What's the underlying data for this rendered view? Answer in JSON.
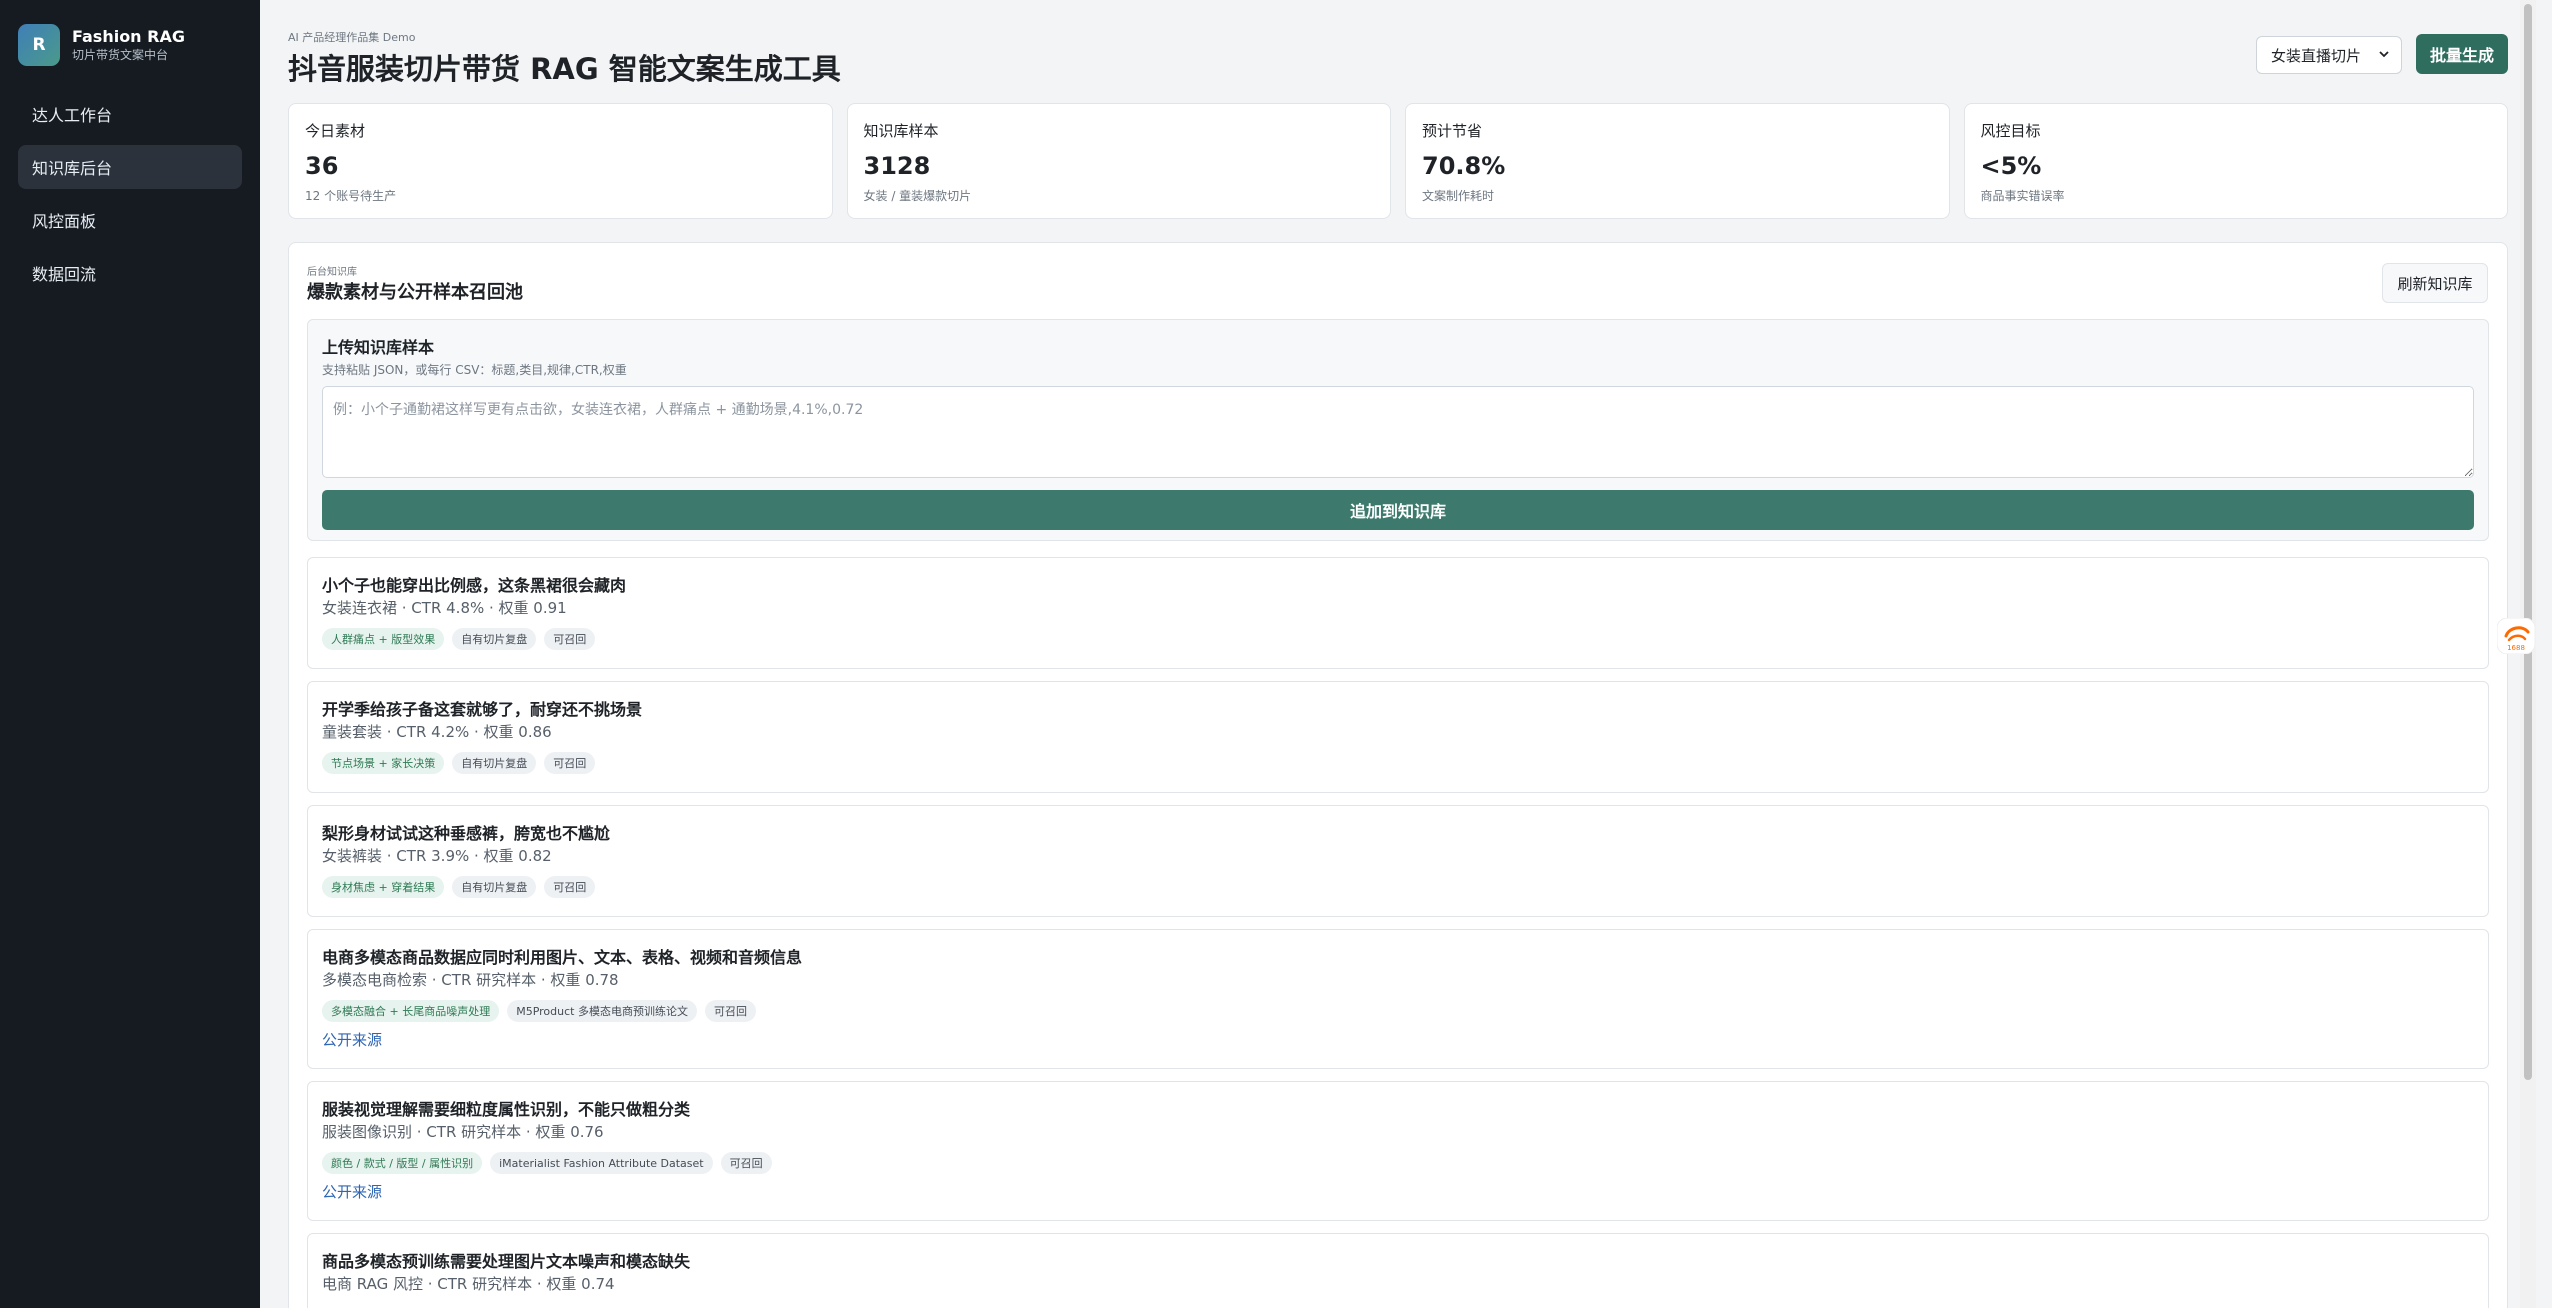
{
  "brand": {
    "logo_letter": "R",
    "name": "Fashion RAG",
    "subtitle": "切片带货文案中台"
  },
  "nav": {
    "items": [
      {
        "label": "达人工作台",
        "active": false
      },
      {
        "label": "知识库后台",
        "active": true
      },
      {
        "label": "风控面板",
        "active": false
      },
      {
        "label": "数据回流",
        "active": false
      }
    ]
  },
  "header": {
    "eyebrow": "AI 产品经理作品集 Demo",
    "title": "抖音服装切片带货 RAG 智能文案生成工具",
    "scene_select": "女装直播切片",
    "batch_button": "批量生成"
  },
  "stats": [
    {
      "label": "今日素材",
      "value": "36",
      "note": "12 个账号待生产"
    },
    {
      "label": "知识库样本",
      "value": "3128",
      "note": "女装 / 童装爆款切片"
    },
    {
      "label": "预计节省",
      "value": "70.8%",
      "note": "文案制作耗时"
    },
    {
      "label": "风控目标",
      "value": "<5%",
      "note": "商品事实错误率"
    }
  ],
  "knowledge": {
    "eyebrow": "后台知识库",
    "title": "爆款素材与公开样本召回池",
    "refresh_button": "刷新知识库",
    "upload": {
      "title": "上传知识库样本",
      "hint": "支持粘贴 JSON，或每行 CSV：标题,类目,规律,CTR,权重",
      "placeholder": "例：小个子通勤裙这样写更有点击欲，女装连衣裙，人群痛点 + 通勤场景,4.1%,0.72",
      "append_button": "追加到知识库"
    },
    "items": [
      {
        "title": "小个子也能穿出比例感，这条黑裙很会藏肉",
        "meta": "女装连衣裙 · CTR 4.8% · 权重 0.91",
        "tags": [
          "人群痛点 + 版型效果",
          "自有切片复盘",
          "可召回"
        ],
        "link": ""
      },
      {
        "title": "开学季给孩子备这套就够了，耐穿还不挑场景",
        "meta": "童装套装 · CTR 4.2% · 权重 0.86",
        "tags": [
          "节点场景 + 家长决策",
          "自有切片复盘",
          "可召回"
        ],
        "link": ""
      },
      {
        "title": "梨形身材试试这种垂感裤，胯宽也不尴尬",
        "meta": "女装裤装 · CTR 3.9% · 权重 0.82",
        "tags": [
          "身材焦虑 + 穿着结果",
          "自有切片复盘",
          "可召回"
        ],
        "link": ""
      },
      {
        "title": "电商多模态商品数据应同时利用图片、文本、表格、视频和音频信息",
        "meta": "多模态电商检索 · CTR 研究样本 · 权重 0.78",
        "tags": [
          "多模态融合 + 长尾商品噪声处理",
          "M5Product 多模态电商预训练论文",
          "可召回"
        ],
        "link": "公开来源"
      },
      {
        "title": "服装视觉理解需要细粒度属性识别，不能只做粗分类",
        "meta": "服装图像识别 · CTR 研究样本 · 权重 0.76",
        "tags": [
          "颜色 / 款式 / 版型 / 属性识别",
          "iMaterialist Fashion Attribute Dataset",
          "可召回"
        ],
        "link": "公开来源"
      },
      {
        "title": "商品多模态预训练需要处理图片文本噪声和模态缺失",
        "meta": "电商 RAG 风控 · CTR 研究样本 · 权重 0.74",
        "tags": [],
        "link": ""
      }
    ]
  },
  "floating_badge": {
    "label": "1688"
  },
  "colors": {
    "sidebar_bg": "#161b22",
    "primary": "#2f6d5f",
    "append": "#3d7a6d",
    "link": "#2f66b3",
    "badge": "#ff6a00"
  }
}
